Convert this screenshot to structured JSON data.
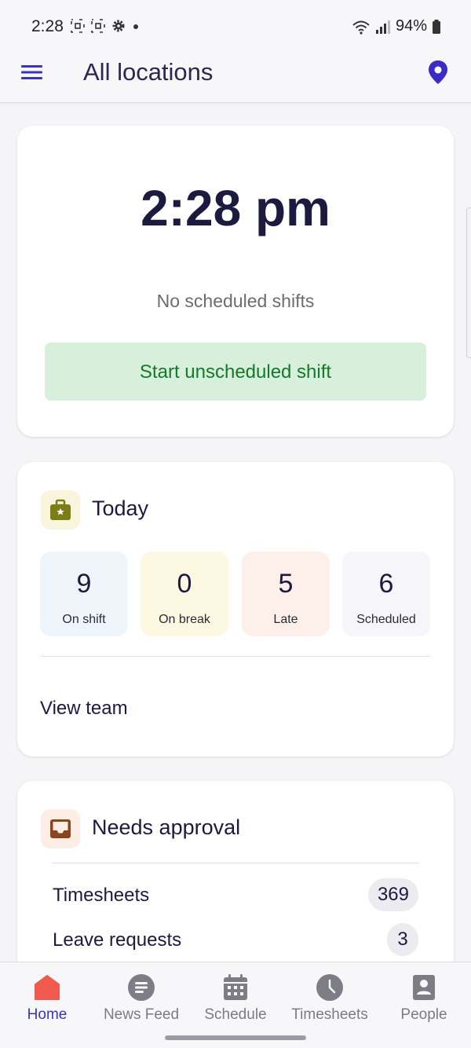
{
  "status_bar": {
    "time": "2:28",
    "battery": "94%"
  },
  "app_bar": {
    "title": "All locations"
  },
  "clock_card": {
    "time": "2:28 pm",
    "no_shifts": "No scheduled shifts",
    "start_button": "Start unscheduled shift"
  },
  "today": {
    "heading": "Today",
    "stats": [
      {
        "value": "9",
        "label": "On shift",
        "color": "#eef6fc"
      },
      {
        "value": "0",
        "label": "On break",
        "color": "#fdf8e1"
      },
      {
        "value": "5",
        "label": "Late",
        "color": "#fdf0ea"
      },
      {
        "value": "6",
        "label": "Scheduled",
        "color": "#f5f5fa"
      }
    ],
    "view_team": "View team"
  },
  "approval": {
    "heading": "Needs approval",
    "rows": [
      {
        "label": "Timesheets",
        "count": "369"
      },
      {
        "label": "Leave requests",
        "count": "3"
      }
    ]
  },
  "nav": {
    "items": [
      {
        "label": "Home",
        "icon": "home-icon",
        "active": true
      },
      {
        "label": "News Feed",
        "icon": "news-feed-icon"
      },
      {
        "label": "Schedule",
        "icon": "calendar-icon"
      },
      {
        "label": "Timesheets",
        "icon": "clock-icon"
      },
      {
        "label": "People",
        "icon": "person-icon"
      }
    ]
  },
  "colors": {
    "accent": "#3a35b5",
    "home_active": "#f05a4f",
    "start_bg": "#d8efdb",
    "start_text": "#137a2a"
  }
}
